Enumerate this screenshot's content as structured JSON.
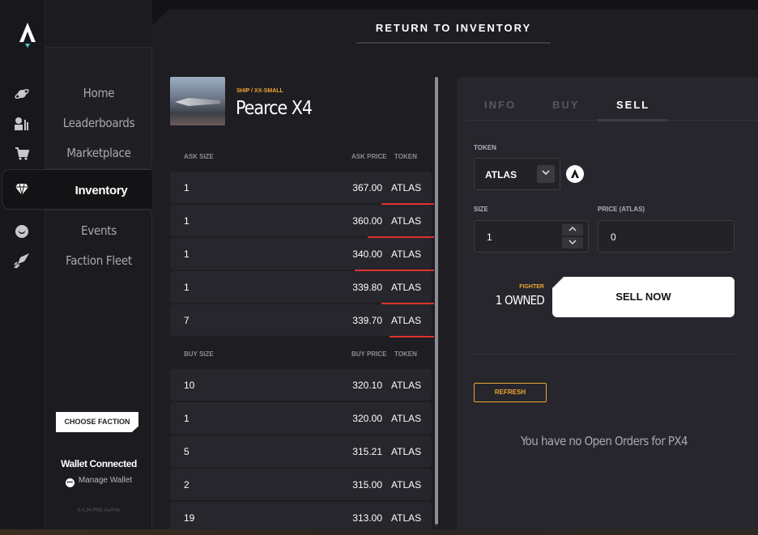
{
  "nav": {
    "items": [
      {
        "label": "Home",
        "icon": "planet-icon"
      },
      {
        "label": "Leaderboards",
        "icon": "leaderboards-icon"
      },
      {
        "label": "Marketplace",
        "icon": "cart-icon"
      },
      {
        "label": "Inventory",
        "icon": "gem-icon",
        "active": true
      },
      {
        "label": "Events",
        "icon": "events-icon"
      },
      {
        "label": "Faction Fleet",
        "icon": "rocket-icon"
      }
    ],
    "choose_faction": "CHOOSE FACTION",
    "wallet_status": "Wallet Connected",
    "manage_wallet": "Manage Wallet",
    "version": "0.4.24 PRE-ALPHA"
  },
  "header": {
    "return_label": "RETURN TO INVENTORY"
  },
  "item": {
    "type": "SHIP / XX-SMALL",
    "name": "Pearce X4"
  },
  "asks": {
    "headers": {
      "size": "ASK SIZE",
      "price": "ASK PRICE",
      "token": "TOKEN"
    },
    "rows": [
      {
        "size": "1",
        "price": "367.00",
        "token": "ATLAS",
        "depth": 0.2
      },
      {
        "size": "1",
        "price": "360.00",
        "token": "ATLAS",
        "depth": 0.25
      },
      {
        "size": "1",
        "price": "340.00",
        "token": "ATLAS",
        "depth": 0.3
      },
      {
        "size": "1",
        "price": "339.80",
        "token": "ATLAS",
        "depth": 0.2
      },
      {
        "size": "7",
        "price": "339.70",
        "token": "ATLAS",
        "depth": 0.17
      }
    ]
  },
  "bids": {
    "headers": {
      "size": "BUY SIZE",
      "price": "BUY PRICE",
      "token": "TOKEN"
    },
    "rows": [
      {
        "size": "10",
        "price": "320.10",
        "token": "ATLAS"
      },
      {
        "size": "1",
        "price": "320.00",
        "token": "ATLAS"
      },
      {
        "size": "5",
        "price": "315.21",
        "token": "ATLAS"
      },
      {
        "size": "2",
        "price": "315.00",
        "token": "ATLAS"
      },
      {
        "size": "19",
        "price": "313.00",
        "token": "ATLAS"
      }
    ]
  },
  "trade": {
    "tabs": [
      {
        "label": "INFO",
        "active": false
      },
      {
        "label": "BUY",
        "active": false
      },
      {
        "label": "SELL",
        "active": true
      }
    ],
    "token_label": "TOKEN",
    "token_value": "ATLAS",
    "size_label": "SIZE",
    "size_value": "1",
    "price_label": "PRICE (ATLAS)",
    "price_value": "0",
    "class_label": "FIGHTER",
    "owned_label": "1 OWNED",
    "sell_button": "SELL NOW",
    "refresh_button": "REFRESH",
    "no_orders": "You have no Open Orders for PX4"
  },
  "colors": {
    "accent": "#f0a630",
    "ask_bar": "#e0322e",
    "panel": "#26262c",
    "background": "#131316"
  }
}
